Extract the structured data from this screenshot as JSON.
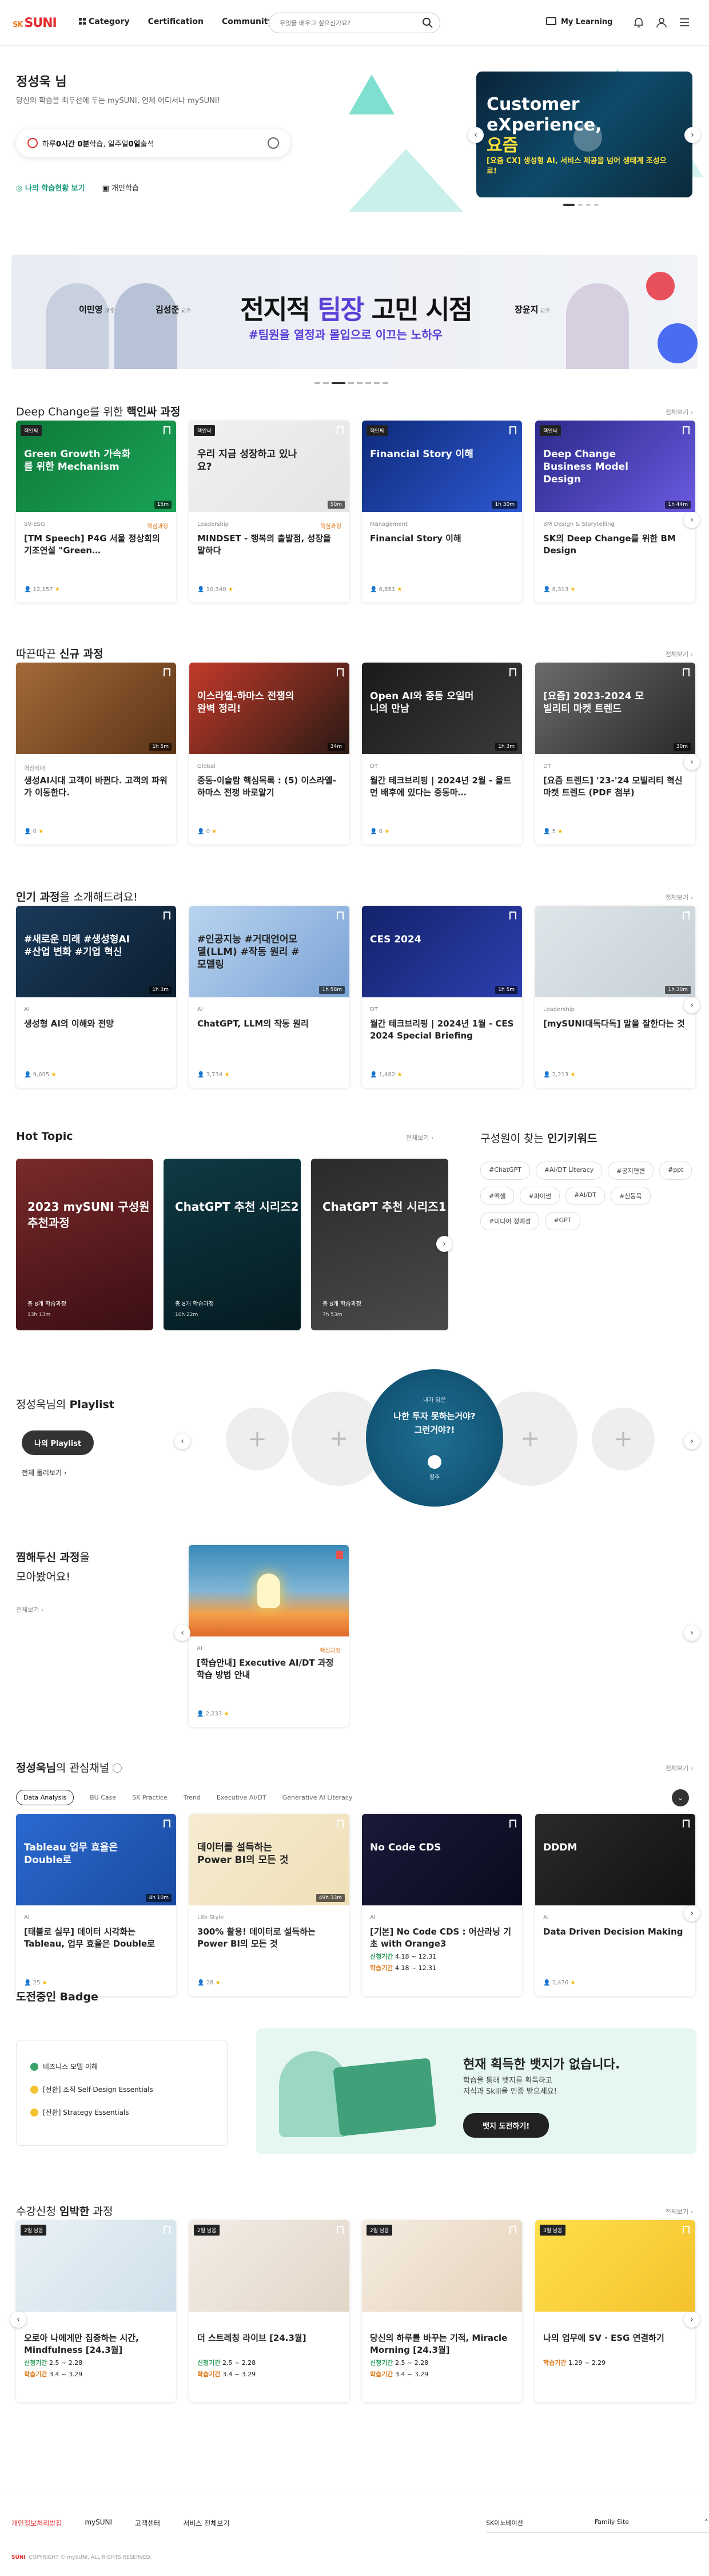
{
  "header": {
    "logo": "SUNI",
    "logo_prefix": "SK",
    "nav": [
      "Category",
      "Certification",
      "Community"
    ],
    "search_placeholder": "무엇을 배우고 싶으신가요?",
    "my_learning": "My Learning"
  },
  "hero": {
    "greeting": "정성욱 님",
    "subtitle": "당신의 학습을 최우선에 두는 mySUNI, 언제 어디서나 mySUNI!",
    "goal_pre": "하루 ",
    "goal_time": "0시간 0분",
    "goal_mid": " 학습, 일주일 ",
    "goal_days": "0일",
    "goal_post": " 출석",
    "link1": "나의 학습현황 보기",
    "link2": "개인학습",
    "card": {
      "title1": "Customer",
      "title2": "eXperience,",
      "title3": "요즘",
      "sub": "[요즘 CX] 생성형 AI, 서비스 제공을 넘어 생태계 조성으로!"
    }
  },
  "banner": {
    "title_pre": "전지적 ",
    "title_hl": "팀장",
    "title_post": " 고민 시점",
    "sub": "#팀원을 열정과 몰입으로 이끄는 노하우",
    "p1": "이민영",
    "p2": "김성준",
    "p3": "장윤지",
    "role": "교수"
  },
  "sec1": {
    "title_pre": "Deep Change를 위한 ",
    "title_b": "핵인싸 과정",
    "more": "전체보기",
    "cards": [
      {
        "tag": "핵인싸",
        "thumb": "Green Growth 가속화를 위한 Mechanism",
        "dur": "15m",
        "cat": "SV-ESG",
        "req": "핵심과정",
        "name": "[TM Speech] P4G 서울 정상회의 기조연설 \"Green…",
        "meta": "12,157",
        "c1": "#0e7a3a",
        "c2": "#1aa358"
      },
      {
        "tag": "핵인싸",
        "thumb": "우리 지금 성장하고 있나요?",
        "dur": "50m",
        "cat": "Leadership",
        "req": "핵심과정",
        "name": "MINDSET - 행복의 출발점, 성장을 말하다",
        "meta": "10,340",
        "c1": "#f1f1f1",
        "c2": "#e4e4e4"
      },
      {
        "tag": "핵인싸",
        "thumb": "Financial Story 이해",
        "dur": "1h 30m",
        "cat": "Management",
        "req": "",
        "name": "Financial Story 이해",
        "meta": "6,851",
        "c1": "#0d2a7a",
        "c2": "#2e58d0"
      },
      {
        "tag": "핵인싸",
        "thumb": "Deep Change Business Model Design",
        "dur": "1h 44m",
        "cat": "BM Design & Storytelling",
        "req": "",
        "name": "SK의 Deep Change를 위한 BM Design",
        "meta": "8,313",
        "c1": "#2b2a8a",
        "c2": "#6a5ae0"
      }
    ]
  },
  "sec2": {
    "title_pre": "따끈따끈 ",
    "title_b": "신규 과정",
    "more": "전체보기",
    "cards": [
      {
        "thumb": "",
        "dur": "1h 5m",
        "cat": "혁신리더",
        "name": "생성AI시대 고객이 바뀐다. 고객의 파워가 이동한다.",
        "meta": "0",
        "c1": "#a26a3a",
        "c2": "#5c3416"
      },
      {
        "thumb": "이스라엘-하마스 전쟁의 완벽 정리!",
        "dur": "34m",
        "cat": "Global",
        "name": "중동-이슬람 핵심목록 : (5) 이스라엘-하마스 전쟁 바로알기",
        "meta": "0",
        "c1": "#c23a2a",
        "c2": "#2a1a14"
      },
      {
        "thumb": "Open AI와 중동 오일머니의 만남",
        "dur": "1h 3m",
        "cat": "DT",
        "name": "월간 테크브리핑 | 2024년 2월 - 올트먼 배후에 있다는 중동마…",
        "meta": "0",
        "c1": "#1a1a1a",
        "c2": "#3a3a3a"
      },
      {
        "thumb": "[요즘] 2023-2024 모빌리티 마켓 트렌드",
        "dur": "30m",
        "cat": "DT",
        "name": "[요즘 트렌드] '23-'24 모빌리티 혁신 마켓 트렌드 (PDF 첨부)",
        "meta": "5",
        "c1": "#6a6a6a",
        "c2": "#2a2a2a"
      }
    ]
  },
  "sec3": {
    "title_pre": "",
    "title_b": "인기 과정",
    "title_post": "을 소개해드려요!",
    "more": "전체보기",
    "cards": [
      {
        "thumb": "#새로운 미래 #생성형AI #산업 변화 #기업 혁신",
        "dur": "1h 3m",
        "cat": "AI",
        "name": "생성형 AI의 이해와 전망",
        "meta": "9,695",
        "c1": "#1a3a5a",
        "c2": "#0c1e30"
      },
      {
        "thumb": "#인공지능 #거대언어모델(LLM) #작동 원리 #모델링",
        "dur": "1h 58m",
        "cat": "AI",
        "name": "ChatGPT, LLM의 작동 원리",
        "meta": "3,734",
        "c1": "#b9d4ef",
        "c2": "#7ba3d6"
      },
      {
        "thumb": "CES 2024",
        "dur": "1h 5m",
        "cat": "DT",
        "name": "월간 테크브리핑 | 2024년 1월 - CES 2024 Special Briefing",
        "meta": "1,482",
        "c1": "#13226a",
        "c2": "#2e3fb0"
      },
      {
        "thumb": "",
        "dur": "1h 30m",
        "cat": "Leadership",
        "name": "[mySUNI대독다독] 말을 잘한다는 것",
        "meta": "2,213",
        "c1": "#dfe6ea",
        "c2": "#c6d0d6"
      }
    ]
  },
  "hot": {
    "title": "Hot Topic",
    "more": "전체보기",
    "items": [
      {
        "t": "2023 mySUNI 구성원 추천과정",
        "ft": "총 8개 학습과정",
        "dur": "13h 13m",
        "c1": "#7a2a2a",
        "c2": "#3a0e14"
      },
      {
        "t": "ChatGPT 추천 시리즈2",
        "ft": "총 8개 학습과정",
        "dur": "10h 22m",
        "c1": "#0e3a44",
        "c2": "#051a20"
      },
      {
        "t": "ChatGPT 추천 시리즈1",
        "ft": "총 8개 학습과정",
        "dur": "7h 53m",
        "c1": "#2a2a2a",
        "c2": "#4a4a4a"
      }
    ]
  },
  "kw": {
    "title_pre": "구성원이 찾는 ",
    "title_b": "인기키워드",
    "items": [
      "#ChatGPT",
      "#AI/DT Literacy",
      "#공지연변",
      "#ppt",
      "#엑셀",
      "#파이썬",
      "#AI/DT",
      "#신동욱",
      "#미다어 정예성",
      "#GPT"
    ]
  },
  "pl": {
    "title_pre": "정성욱님의 ",
    "title_b": "Playlist",
    "btn": "나의 Playlist",
    "all": "전체 둘러보기",
    "center_tag": "내가 담은",
    "center_t": "나한 투자 못하는거야? 그런거야?!",
    "center_who": "정주"
  },
  "fav": {
    "t1_b": "찜해두신 과정",
    "t1": "을",
    "t2": "모아봤어요!",
    "more": "전체보기",
    "card": {
      "cat": "AI",
      "req": "핵심과정",
      "name": "[학습안내] Executive AI/DT 과정 학습 방법 안내",
      "meta": "2,233"
    }
  },
  "int": {
    "title_pre": "정성욱님",
    "title_post": "의 관심채널",
    "more": "전체보기",
    "chips": [
      "Data Analysis",
      "BU Case",
      "SK Practice",
      "Trend",
      "Executive AI/DT",
      "Generative AI Literacy"
    ],
    "cards": [
      {
        "thumb": "Tableau 업무 효율은 Double로",
        "dur": "4h 10m",
        "cat": "AI",
        "name": "[태블로 실무] 데이터 시각화는 Tableau, 업무 효율은 Double로",
        "meta": "25",
        "c1": "#2a6ad0",
        "c2": "#1a4aa0"
      },
      {
        "thumb": "데이터를 설득하는 Power BI의 모든 것",
        "dur": "49h 33m",
        "cat": "Life Style",
        "name": "300% 활용! 데이터로 설득하는 Power BI의 모든 것",
        "meta": "28",
        "c1": "#f6ecd2",
        "c2": "#efdfb6"
      },
      {
        "thumb": "No Code CDS",
        "dur": "",
        "cat": "AI",
        "name": "[기본] No Code CDS : 어산라닝 기초 with Orange3",
        "p1": "신청기간",
        "p1v": "4.18 ~ 12.31",
        "p2": "학습기간",
        "p2v": "4.18 ~ 12.31",
        "meta": "",
        "c1": "#1a1a3a",
        "c2": "#0a0a1e"
      },
      {
        "thumb": "DDDM",
        "dur": "",
        "cat": "AI",
        "name": "Data Driven Decision Making",
        "meta": "2,476",
        "c1": "#2a2a2a",
        "c2": "#111"
      }
    ]
  },
  "badge": {
    "title": "도전중인 Badge",
    "items": [
      "비즈니스 모델 이해",
      "[전환] 조직 Self-Design Essentials",
      "[전환] Strategy Essentials"
    ],
    "promo_t": "현재 획득한 뱃지가 없습니다.",
    "promo_s1": "학습을 통해 뱃지를 획득하고",
    "promo_s2": "지식과 Skill을 인증 받으세요!",
    "promo_b": "뱃지 도전하기!"
  },
  "soon": {
    "title_pre": "수강신청 ",
    "title_b": "임박한",
    "title_post": " 과정",
    "more": "전체보기",
    "cards": [
      {
        "tag": "2일 남음",
        "name": "오로아 나에게만 집중하는 시간, Mindfulness [24.3월]",
        "p1v": "2.5 ~ 2.28",
        "p2v": "3.4 ~ 3.29",
        "c1": "#e9f1f6",
        "c2": "#cfe0ea"
      },
      {
        "tag": "2일 남음",
        "name": "더 스트레칭 라이브 [24.3월]",
        "p1v": "2.5 ~ 2.28",
        "p2v": "3.4 ~ 3.29",
        "c1": "#f3ede6",
        "c2": "#e2d6c8"
      },
      {
        "tag": "2일 남음",
        "name": "당신의 하루를 바꾸는 기적, Miracle Morning [24.3월]",
        "p1v": "2.5 ~ 2.28",
        "p2v": "3.4 ~ 3.29",
        "c1": "#f5ece0",
        "c2": "#e6d3bc"
      },
      {
        "tag": "3일 남음",
        "name": "나의 업무에 SV · ESG 연결하기",
        "p1v": "",
        "p2v": "1.29 ~ 2.29",
        "c1": "#ffe04a",
        "c2": "#f3c22e"
      }
    ],
    "p1": "신청기간",
    "p2": "학습기간"
  },
  "footer": {
    "links": [
      "개인정보처리방침",
      "mySUNI",
      "고객센터",
      "서비스 전체보기"
    ],
    "sel1": "SK이노베이션",
    "sel2": "Family Site",
    "copy": "COPYRIGHT © mySUNI. ALL RIGHTS RESERVED."
  }
}
